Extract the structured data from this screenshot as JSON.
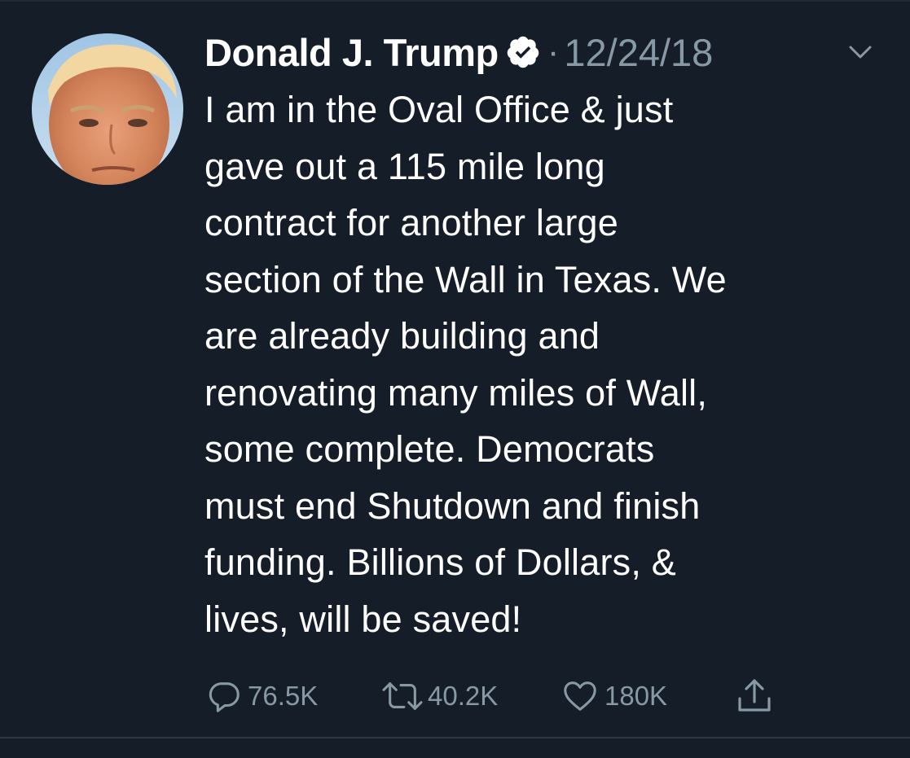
{
  "tweet": {
    "author_name": "Donald J. Trump",
    "verified": true,
    "separator": "·",
    "timestamp": "12/24/18",
    "text": "I am in the Oval Office & just\ngave out a 115 mile long\ncontract for another large\nsection of the Wall in Texas. We\nare already building and\nrenovating many miles of Wall,\nsome complete. Democrats\nmust end Shutdown and finish\nfunding. Billions of Dollars, &\nlives, will be saved!"
  },
  "actions": {
    "reply_count": "76.5K",
    "retweet_count": "40.2K",
    "like_count": "180K"
  },
  "icons": {
    "reply": "reply-icon",
    "retweet": "retweet-icon",
    "like": "heart-icon",
    "share": "share-icon",
    "verified": "verified-badge-icon",
    "menu": "chevron-down-icon"
  },
  "colors": {
    "background": "#151d28",
    "text": "#ffffff",
    "secondary_text": "#8899a6"
  }
}
